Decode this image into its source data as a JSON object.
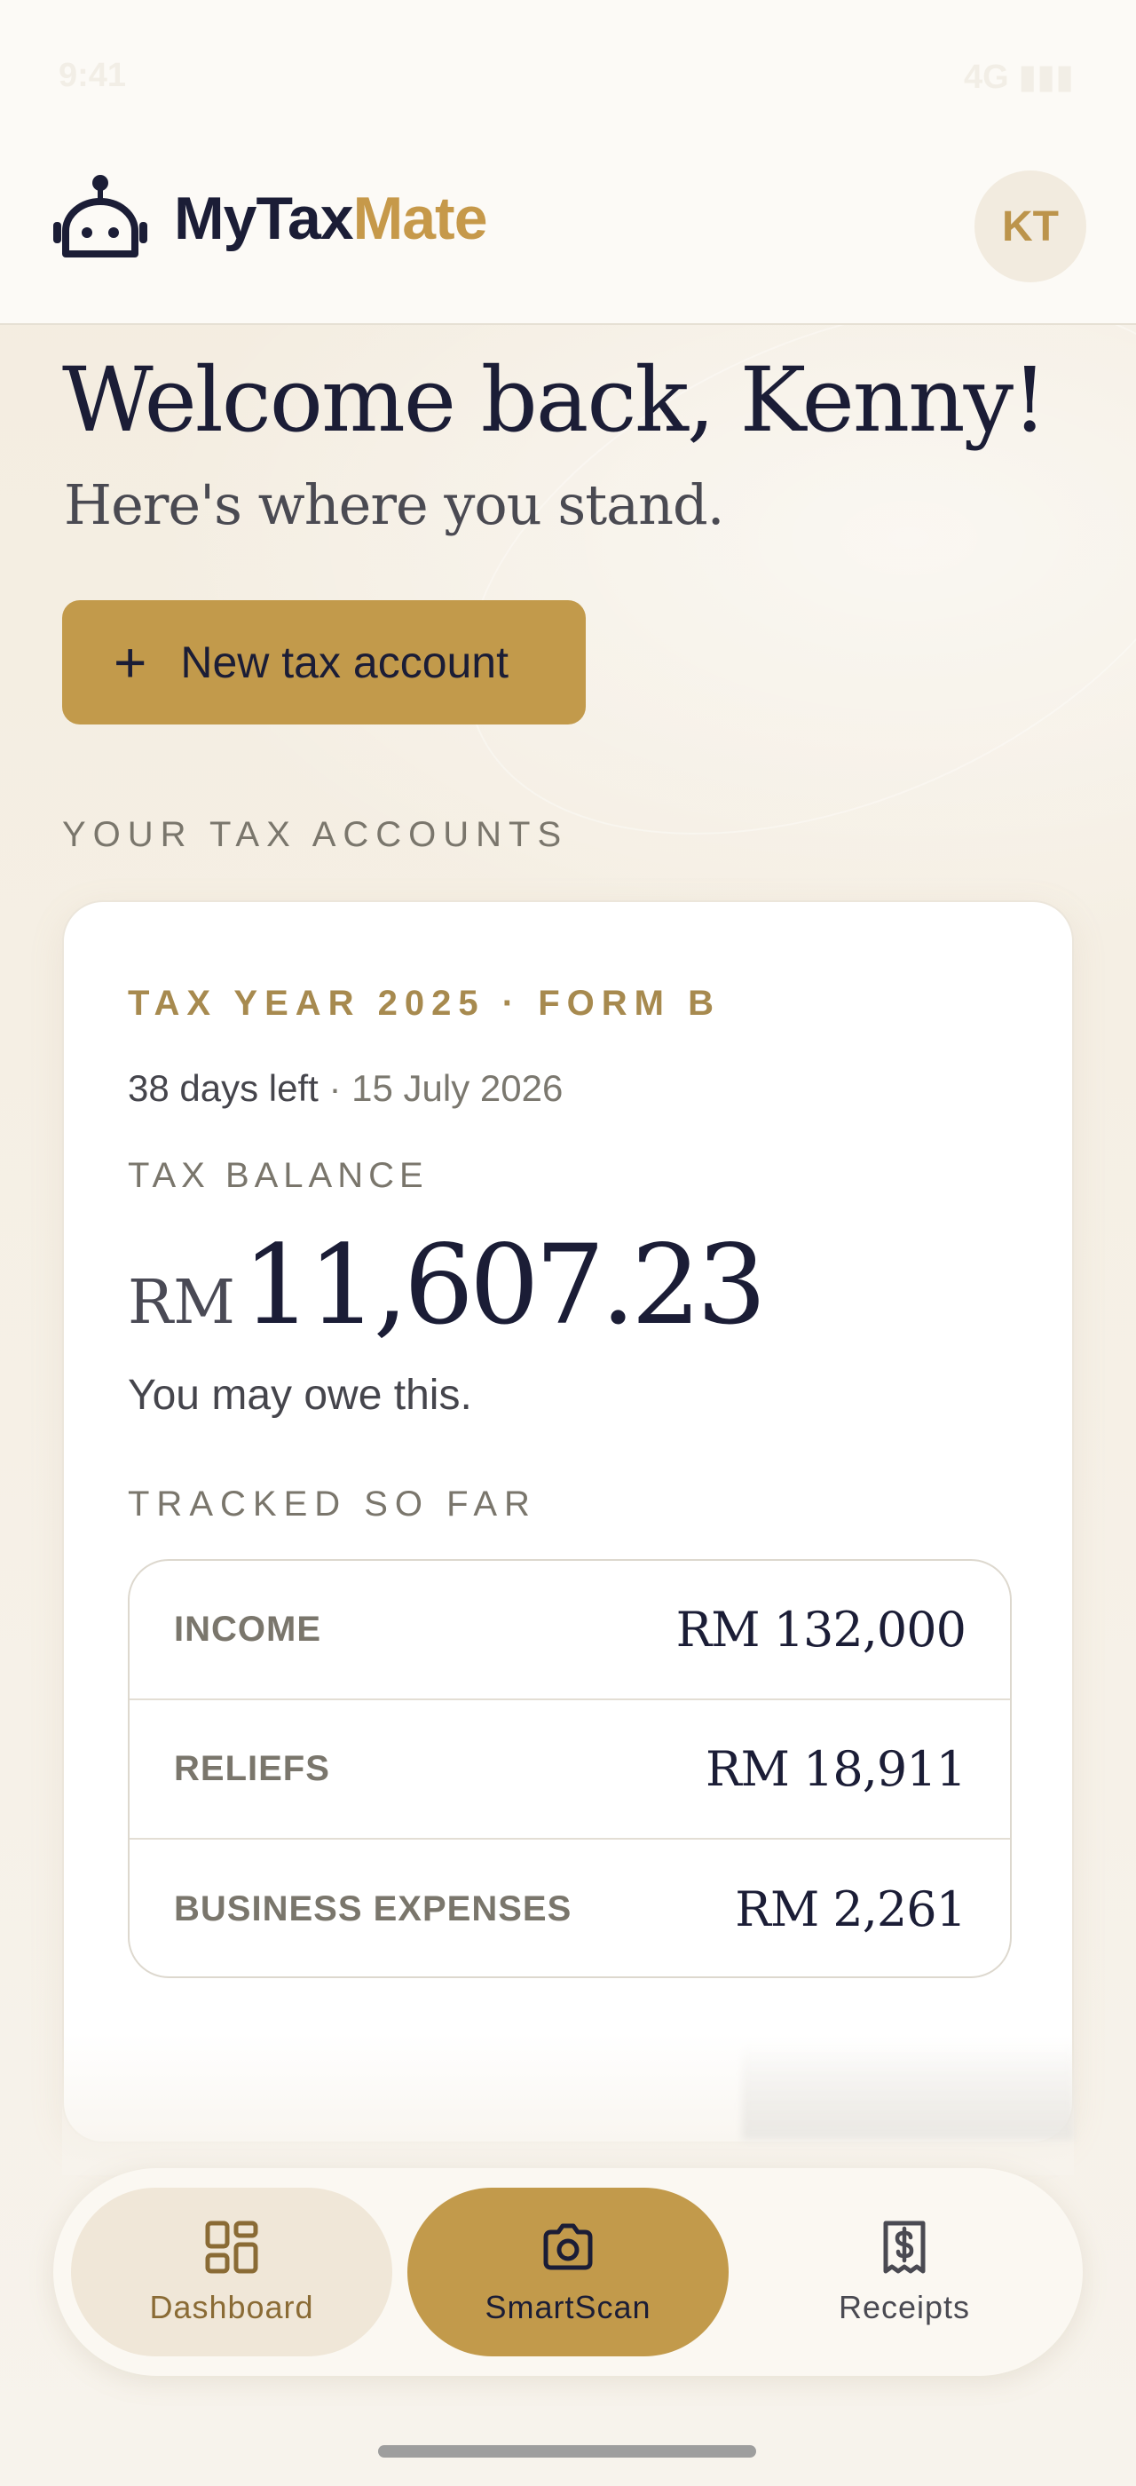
{
  "status_bar": {
    "time": "9:41",
    "right": "4G ▮▮▮"
  },
  "header": {
    "logo_part1": "MyTax",
    "logo_part2": "Mate",
    "avatar_initials": "KT"
  },
  "welcome": {
    "title": "Welcome back, Kenny!",
    "subtitle": "Here's where you stand."
  },
  "actions": {
    "new_account_icon": "+",
    "new_account_label": "New tax account"
  },
  "section": {
    "accounts_label": "YOUR TAX ACCOUNTS"
  },
  "account_card": {
    "eyebrow": "TAX YEAR 2025 · FORM B",
    "days_left": "38 days left",
    "due_date": "· 15 July 2026",
    "balance_label": "TAX BALANCE",
    "balance_currency": "RM",
    "balance_amount": "11,607.23",
    "balance_note": "You may owe this.",
    "tracked_label": "TRACKED SO FAR",
    "tracked": [
      {
        "name": "INCOME",
        "value": "RM 132,000"
      },
      {
        "name": "RELIEFS",
        "value": "RM 18,911"
      },
      {
        "name": "BUSINESS EXPENSES",
        "value": "RM 2,261"
      }
    ]
  },
  "nav": {
    "dashboard": "Dashboard",
    "smartscan": "SmartScan",
    "receipts": "Receipts"
  },
  "colors": {
    "accent": "#c29a4b",
    "navy": "#1b1d36",
    "muted": "#7a766c"
  },
  "icons": {
    "logo": "robot-icon",
    "dashboard": "grid-icon",
    "smartscan": "camera-icon",
    "receipts": "receipt-dollar-icon"
  }
}
